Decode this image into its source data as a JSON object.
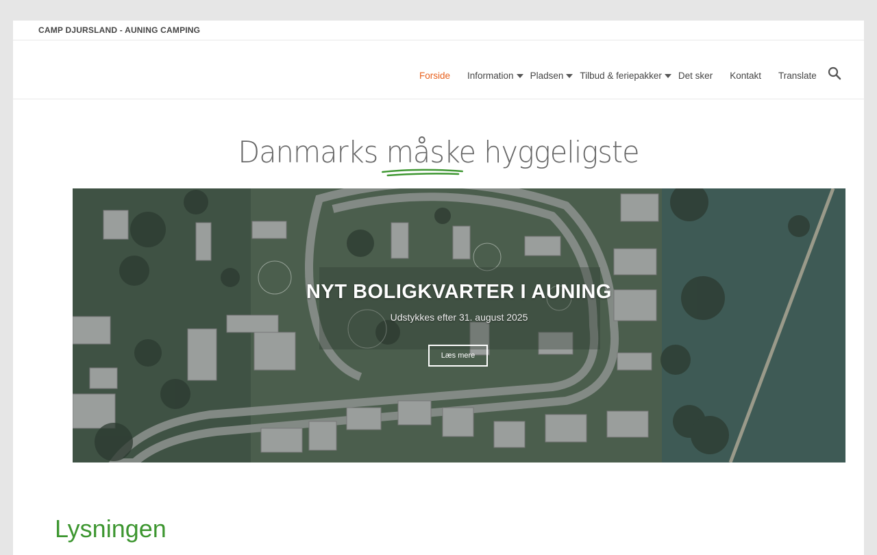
{
  "site": {
    "title": "CAMP DJURSLAND - AUNING CAMPING"
  },
  "nav": {
    "items": [
      {
        "label": "Forside",
        "active": true,
        "dropdown": false
      },
      {
        "label": "Information",
        "active": false,
        "dropdown": true
      },
      {
        "label": "Pladsen",
        "active": false,
        "dropdown": true
      },
      {
        "label": "Tilbud & feriepakker",
        "active": false,
        "dropdown": true
      },
      {
        "label": "Det sker",
        "active": false,
        "dropdown": false
      },
      {
        "label": "Kontakt",
        "active": false,
        "dropdown": false
      },
      {
        "label": "Translate",
        "active": false,
        "dropdown": false
      }
    ],
    "search_icon": "search-icon",
    "active_color": "#e8601c"
  },
  "tagline": {
    "pre": "Danmarks ",
    "mid": "måske",
    "post": " hyggeligste"
  },
  "banner": {
    "title": "NYT BOLIGKVARTER I AUNING",
    "subtitle": "Udstykkes efter 31. august 2025",
    "button_label": "Læs mere"
  },
  "section": {
    "heading": "Lysningen"
  },
  "colors": {
    "accent_green": "#3d9630",
    "banner_bg": "#4a5d4c"
  }
}
